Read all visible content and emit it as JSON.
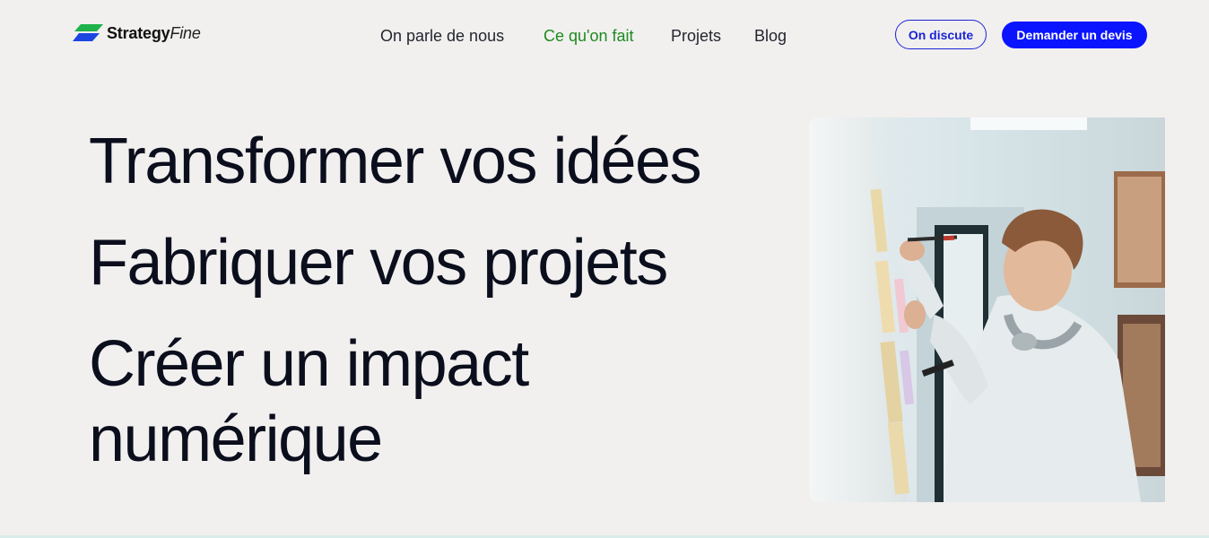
{
  "brand": {
    "name_strong": "Strategy",
    "name_light": "Fine",
    "colors": {
      "mark_green": "#1fb24a",
      "mark_blue": "#1b46e0"
    }
  },
  "nav": {
    "items": [
      {
        "label": "On parle de nous",
        "active": false
      },
      {
        "label": "Ce qu'on fait",
        "active": true
      },
      {
        "label": "Projets",
        "active": false
      },
      {
        "label": "Blog",
        "active": false
      }
    ]
  },
  "actions": {
    "talk_label": "On discute",
    "quote_label": "Demander un devis"
  },
  "hero": {
    "lines": [
      "Transformer vos idées",
      "Fabriquer vos projets",
      "Créer un impact",
      "numérique"
    ]
  },
  "colors": {
    "background": "#f1f0ef",
    "accent_blue": "#0a14ff",
    "active_nav": "#1f8a1f",
    "text": "#0b0e1c"
  },
  "icons": {
    "logo": "strategyfine-logo-mark"
  }
}
